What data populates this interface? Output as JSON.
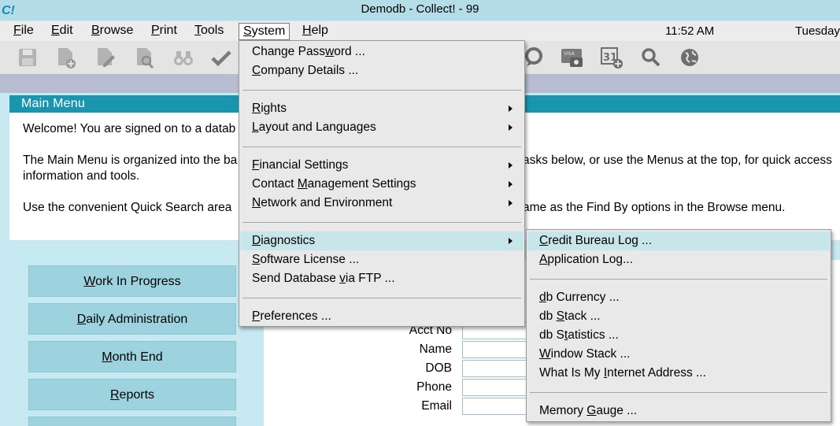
{
  "window": {
    "title": "Demodb - Collect! - 99",
    "logo_text": "C!"
  },
  "menubar": {
    "items": [
      {
        "label": "File",
        "ul": "F",
        "rest": "ile"
      },
      {
        "label": "Edit",
        "ul": "E",
        "rest": "dit"
      },
      {
        "label": "Browse",
        "ul": "B",
        "rest": "rowse"
      },
      {
        "label": "Print",
        "ul": "P",
        "rest": "rint"
      },
      {
        "label": "Tools",
        "ul": "T",
        "rest": "ools"
      },
      {
        "label": "System",
        "ul": "S",
        "rest": "ystem"
      },
      {
        "label": "Help",
        "ul": "H",
        "rest": "elp"
      }
    ],
    "clock": "11:52 AM",
    "weekday": "Tuesday"
  },
  "toolbar": {
    "icons": [
      "save-icon",
      "new-document-icon",
      "edit-document-icon",
      "search-document-icon",
      "binoculars-icon",
      "checkmark-icon",
      "chat-bubble-icon",
      "visa-card-icon",
      "calendar-add-icon",
      "magnifier-icon",
      "globe-icon"
    ]
  },
  "main": {
    "header": "Main Menu",
    "welcome_line": "Welcome! You are signed on to a datab",
    "organized_line1_a": "The Main Menu is organized into the ba",
    "organized_line1_b": "asks below, or use the Menus at the top, for quick access",
    "organized_line2": "information and tools.",
    "quicksearch_a": "Use the convenient Quick Search area",
    "quicksearch_b": "ame as the Find By options in the Browse menu.",
    "nav_buttons": [
      {
        "pre": "",
        "ul": "W",
        "rest": "ork In Progress"
      },
      {
        "pre": "",
        "ul": "D",
        "rest": "aily Administration"
      },
      {
        "pre": "",
        "ul": "M",
        "rest": "onth End"
      },
      {
        "pre": "",
        "ul": "R",
        "rest": "eports"
      }
    ],
    "quick_search": {
      "labels": [
        "Acct No",
        "Name",
        "DOB",
        "Phone",
        "Email"
      ],
      "values": [
        "",
        "",
        "",
        "",
        ""
      ]
    }
  },
  "system_menu": {
    "change_password": {
      "a": "Change Pass",
      "ul": "w",
      "b": "ord ..."
    },
    "company_details": {
      "a": "",
      "ul": "C",
      "b": "ompany Details ..."
    },
    "rights": {
      "a": "",
      "ul": "R",
      "b": "ights"
    },
    "layout": {
      "a": "",
      "ul": "L",
      "b": "ayout and Languages"
    },
    "financial": {
      "a": "",
      "ul": "F",
      "b": "inancial Settings"
    },
    "contact": {
      "a": "Contact ",
      "ul": "M",
      "b": "anagement Settings"
    },
    "network": {
      "a": "",
      "ul": "N",
      "b": "etwork and Environment"
    },
    "diagnostics": {
      "a": "",
      "ul": "D",
      "b": "iagnostics"
    },
    "license": {
      "a": "",
      "ul": "S",
      "b": "oftware License ..."
    },
    "ftp": {
      "a": "Send Database ",
      "ul": "v",
      "b": "ia FTP ..."
    },
    "preferences": {
      "a": "",
      "ul": "P",
      "b": "references ..."
    }
  },
  "diagnostics_menu": {
    "credit": {
      "a": "",
      "ul": "C",
      "b": "redit Bureau Log ..."
    },
    "applog": {
      "a": "",
      "ul": "A",
      "b": "pplication Log..."
    },
    "currency": {
      "a": "",
      "ul": "d",
      "b": "b Currency ..."
    },
    "stack": {
      "a": "db ",
      "ul": "S",
      "b": "tack ..."
    },
    "stats": {
      "a": "db S",
      "ul": "t",
      "b": "atistics ..."
    },
    "winstack": {
      "a": "",
      "ul": "W",
      "b": "indow Stack ..."
    },
    "ip": {
      "a": "What Is My ",
      "ul": "I",
      "b": "nternet Address ..."
    },
    "memory": {
      "a": "Memory ",
      "ul": "G",
      "b": "auge ..."
    }
  },
  "colors": {
    "accent": "#1a95b0",
    "nav_button": "#9dd3df",
    "background": "#c7e9f1",
    "highlight": "#c7e6ea"
  }
}
